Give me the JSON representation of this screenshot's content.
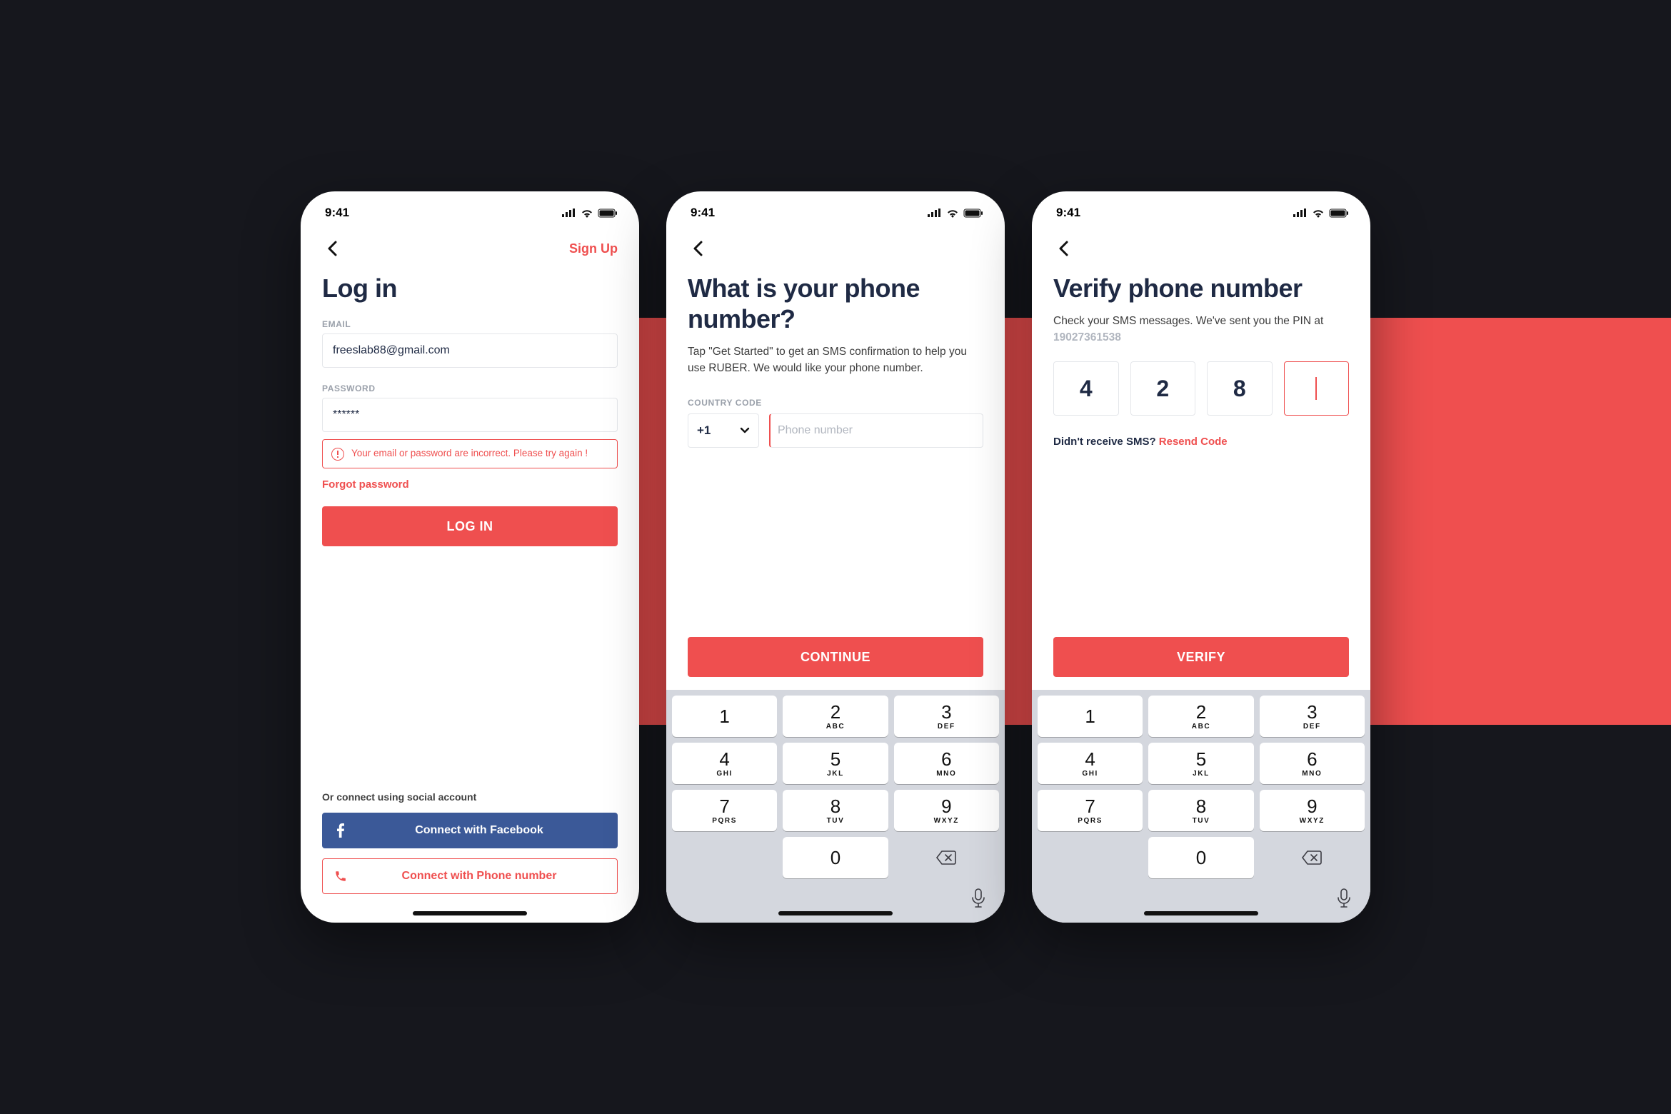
{
  "shared": {
    "status_time": "9:41",
    "keypad": [
      {
        "n": "1",
        "l": ""
      },
      {
        "n": "2",
        "l": "ABC"
      },
      {
        "n": "3",
        "l": "DEF"
      },
      {
        "n": "4",
        "l": "GHI"
      },
      {
        "n": "5",
        "l": "JKL"
      },
      {
        "n": "6",
        "l": "MNO"
      },
      {
        "n": "7",
        "l": "PQRS"
      },
      {
        "n": "8",
        "l": "TUV"
      },
      {
        "n": "9",
        "l": "WXYZ"
      },
      {
        "n": "0",
        "l": ""
      }
    ]
  },
  "screens": {
    "login": {
      "signup_link": "Sign Up",
      "title": "Log in",
      "email_label": "EMAIL",
      "email_value": "freeslab88@gmail.com",
      "password_label": "PASSWORD",
      "password_value": "******",
      "error_msg": "Your email or password are incorrect. Please try again !",
      "forgot": "Forgot password",
      "login_btn": "LOG IN",
      "social_label": "Or connect using social account",
      "fb_btn": "Connect with Facebook",
      "phone_btn": "Connect with Phone number"
    },
    "phone": {
      "title": "What is your phone number?",
      "subtitle": "Tap \"Get Started\" to get an SMS confirmation to help you use RUBER. We would like your phone number.",
      "cc_label": "COUNTRY CODE",
      "cc_value": "+1",
      "phone_placeholder": "Phone number",
      "phone_value": "",
      "continue_btn": "CONTINUE"
    },
    "verify": {
      "title": "Verify phone number",
      "subtitle_pre": "Check your SMS messages. We've sent you the PIN at ",
      "subtitle_num": "19027361538",
      "pins": [
        "4",
        "2",
        "8",
        ""
      ],
      "resend_pre": "Didn't receive SMS? ",
      "resend_link": "Resend Code",
      "verify_btn": "VERIFY"
    }
  }
}
